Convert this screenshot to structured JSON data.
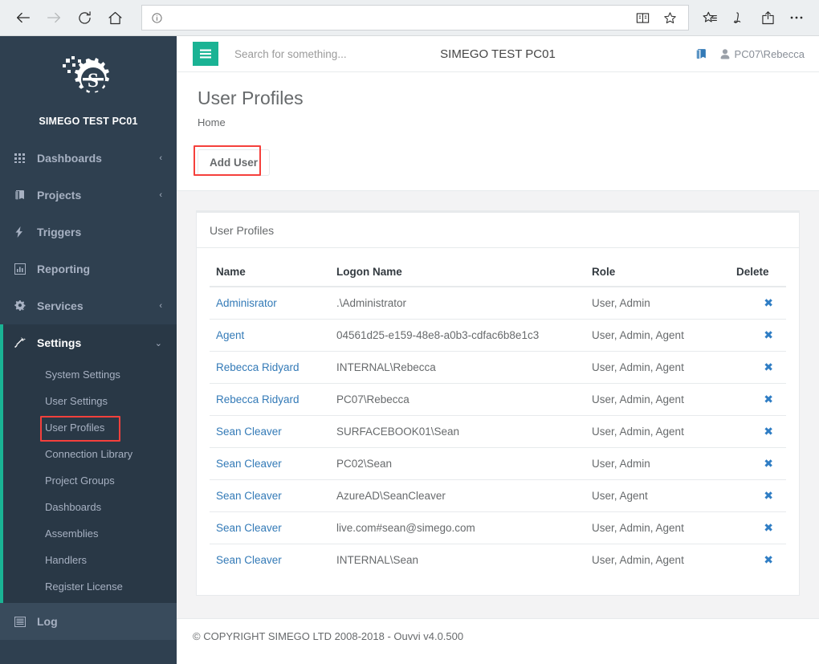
{
  "browser": {
    "back_icon": "back-arrow-icon",
    "forward_icon": "forward-arrow-icon",
    "refresh_icon": "refresh-icon",
    "home_icon": "home-icon",
    "address_value": "",
    "address_placeholder": "",
    "info_icon": "info-icon",
    "reading_view_icon": "reading-view-icon",
    "favorite_icon": "star-icon",
    "hub_icon": "hub-icon",
    "web_note_icon": "web-note-pen-icon",
    "share_icon": "share-icon",
    "more_icon": "more-options-icon"
  },
  "sidebar": {
    "brand_name": "SIMEGO TEST PC01",
    "logo_icon": "simego-gear-logo",
    "items": [
      {
        "label": "Dashboards",
        "icon": "grid-icon",
        "caret": "‹",
        "has_caret": true
      },
      {
        "label": "Projects",
        "icon": "book-icon",
        "caret": "‹",
        "has_caret": true
      },
      {
        "label": "Triggers",
        "icon": "bolt-icon",
        "caret": "",
        "has_caret": false
      },
      {
        "label": "Reporting",
        "icon": "bar-chart-icon",
        "caret": "",
        "has_caret": false
      },
      {
        "label": "Services",
        "icon": "gears-icon",
        "caret": "‹",
        "has_caret": true
      }
    ],
    "settings": {
      "label": "Settings",
      "icon": "magic-wand-icon",
      "caret": "⌄",
      "expanded": true,
      "subitems": [
        {
          "label": "System Settings",
          "highlighted": false
        },
        {
          "label": "User Settings",
          "highlighted": false
        },
        {
          "label": "User Profiles",
          "highlighted": true
        },
        {
          "label": "Connection Library",
          "highlighted": false
        },
        {
          "label": "Project Groups",
          "highlighted": false
        },
        {
          "label": "Dashboards",
          "highlighted": false
        },
        {
          "label": "Assemblies",
          "highlighted": false
        },
        {
          "label": "Handlers",
          "highlighted": false
        },
        {
          "label": "Register License",
          "highlighted": false
        }
      ]
    },
    "log": {
      "label": "Log",
      "icon": "list-icon"
    },
    "accent_color": "#1ab394",
    "bg_color": "#2f4050"
  },
  "topbar": {
    "menu_toggle_icon": "hamburger-icon",
    "search_placeholder": "Search for something...",
    "search_value": "",
    "title": "SIMEGO TEST PC01",
    "help_icon": "book-icon",
    "user_icon": "user-icon",
    "user_name": "PC07\\Rebecca"
  },
  "page": {
    "title": "User Profiles",
    "breadcrumb": "Home",
    "add_user_label": "Add User"
  },
  "panel": {
    "title": "User Profiles",
    "columns": [
      "Name",
      "Logon Name",
      "Role",
      "Delete"
    ],
    "delete_icon": "delete-x-icon",
    "rows": [
      {
        "name": "Adminisrator",
        "logon": ".\\Administrator",
        "role": "User, Admin"
      },
      {
        "name": "Agent",
        "logon": "04561d25-e159-48e8-a0b3-cdfac6b8e1c3",
        "role": "User, Admin, Agent"
      },
      {
        "name": "Rebecca Ridyard",
        "logon": "INTERNAL\\Rebecca",
        "role": "User, Admin, Agent"
      },
      {
        "name": "Rebecca Ridyard",
        "logon": "PC07\\Rebecca",
        "role": "User, Admin, Agent"
      },
      {
        "name": "Sean Cleaver",
        "logon": "SURFACEBOOK01\\Sean",
        "role": "User, Admin, Agent"
      },
      {
        "name": "Sean Cleaver",
        "logon": "PC02\\Sean",
        "role": "User, Admin"
      },
      {
        "name": "Sean Cleaver",
        "logon": "AzureAD\\SeanCleaver",
        "role": "User, Agent"
      },
      {
        "name": "Sean Cleaver",
        "logon": "live.com#sean@simego.com",
        "role": "User, Admin, Agent"
      },
      {
        "name": "Sean Cleaver",
        "logon": "INTERNAL\\Sean",
        "role": "User, Admin, Agent"
      }
    ]
  },
  "footer": {
    "copyright": "© COPYRIGHT SIMEGO LTD 2008-2018 - Ouvvi v4.0.500"
  }
}
